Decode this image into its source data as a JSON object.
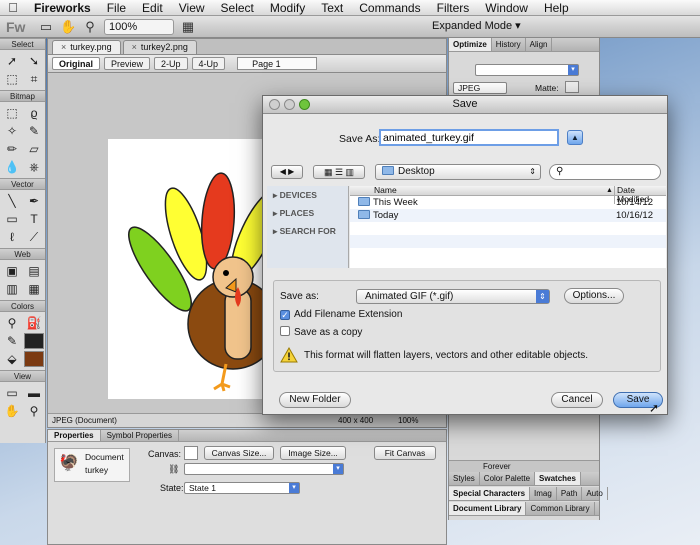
{
  "menubar": {
    "app_name": "Fireworks",
    "items": [
      "File",
      "Edit",
      "View",
      "Select",
      "Modify",
      "Text",
      "Commands",
      "Filters",
      "Window",
      "Help"
    ]
  },
  "apptoolbar": {
    "logo": "Fw",
    "zoom": "100%",
    "mode": "Expanded Mode"
  },
  "tools": {
    "sections": [
      "Select",
      "Bitmap",
      "Vector",
      "Web",
      "Colors",
      "View"
    ]
  },
  "document": {
    "tabs": [
      "turkey.png",
      "turkey2.png"
    ],
    "views": [
      "Original",
      "Preview",
      "2-Up",
      "4-Up"
    ],
    "page": "Page 1",
    "status": "JPEG (Document)",
    "size": "400 x 400",
    "zoom": "100%"
  },
  "properties": {
    "tabs": [
      "Properties",
      "Symbol Properties"
    ],
    "doc_label": "Document",
    "doc_name": "turkey",
    "canvas_label": "Canvas:",
    "canvas_size_btn": "Canvas Size...",
    "image_size_btn": "Image Size...",
    "fit_canvas_btn": "Fit Canvas",
    "state_label": "State:",
    "state_value": "State 1"
  },
  "rightpanel": {
    "top_tabs": [
      "Optimize",
      "History",
      "Align"
    ],
    "format": "JPEG",
    "matte_label": "Matte:",
    "bottom_row1": [
      "Styles",
      "Color Palette",
      "Swatches"
    ],
    "forever": "Forever",
    "bottom_row2": [
      "Special Characters",
      "Imag",
      "Path",
      "Auto"
    ],
    "bottom_row3": [
      "Document Library",
      "Common Library"
    ]
  },
  "dialog": {
    "title": "Save",
    "save_as_label": "Save As:",
    "filename": "animated_turkey.gif",
    "location": "Desktop",
    "sidebar": [
      "DEVICES",
      "PLACES",
      "SEARCH FOR"
    ],
    "col_name": "Name",
    "col_date": "Date Modified",
    "files": [
      {
        "name": "This Week",
        "date": "10/14/12"
      },
      {
        "name": "Today",
        "date": "10/16/12"
      }
    ],
    "format_label": "Save as:",
    "format_value": "Animated GIF (*.gif)",
    "options_btn": "Options...",
    "add_ext_label": "Add Filename Extension",
    "add_ext_checked": true,
    "save_copy_label": "Save as a copy",
    "save_copy_checked": false,
    "warning": "This format will flatten layers, vectors and other editable objects.",
    "new_folder_btn": "New Folder",
    "cancel_btn": "Cancel",
    "save_btn": "Save"
  }
}
